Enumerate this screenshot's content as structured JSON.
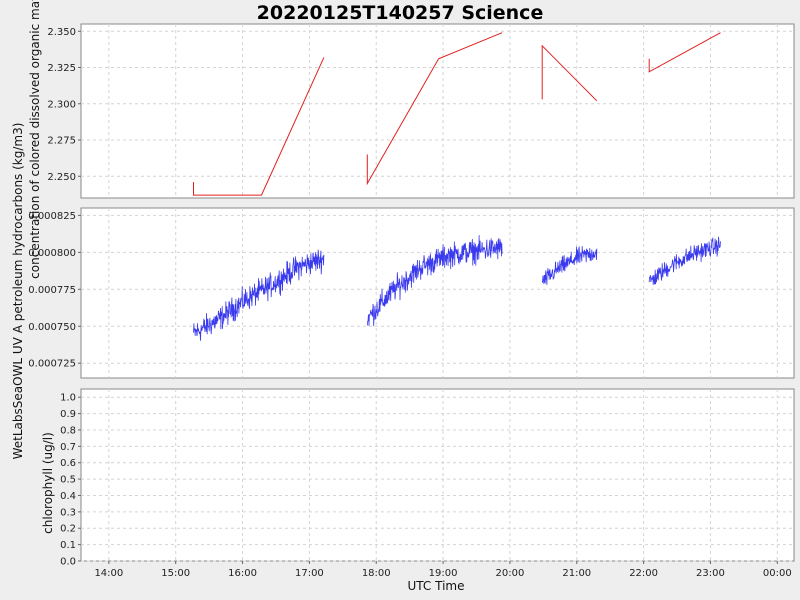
{
  "chart_data": {
    "type": "line",
    "title": "20220125T140257 Science",
    "xlabel": "UTC Time",
    "x_ticks": [
      "14:00",
      "15:00",
      "16:00",
      "17:00",
      "18:00",
      "19:00",
      "20:00",
      "21:00",
      "22:00",
      "23:00",
      "00:00"
    ],
    "xlim": [
      "13:35",
      "00:15"
    ],
    "shared_x": true,
    "grid": true,
    "panels": [
      {
        "ylabel": "concentration of colored dissolved organic matter (ppb)",
        "ylim": [
          2.235,
          2.355
        ],
        "y_ticks": [
          2.25,
          2.275,
          2.3,
          2.325,
          2.35
        ],
        "y_tick_labels": [
          "2.250",
          "2.275",
          "2.300",
          "2.325",
          "2.350"
        ],
        "color": "#e02020",
        "noisy": false,
        "segments": [
          {
            "points": [
              [
                "15:16",
                2.246
              ],
              [
                "15:16",
                2.237
              ],
              [
                "16:17",
                2.237
              ],
              [
                "17:13",
                2.332
              ]
            ]
          },
          {
            "points": [
              [
                "17:52",
                2.265
              ],
              [
                "17:52",
                2.245
              ],
              [
                "18:56",
                2.331
              ],
              [
                "19:53",
                2.349
              ]
            ]
          },
          {
            "points": [
              [
                "20:29",
                2.303
              ],
              [
                "20:29",
                2.34
              ],
              [
                "21:18",
                2.302
              ]
            ]
          },
          {
            "points": [
              [
                "22:05",
                2.331
              ],
              [
                "22:05",
                2.322
              ],
              [
                "23:09",
                2.349
              ]
            ]
          }
        ]
      },
      {
        "ylabel": "WetLabsSeaOWL UV A petroleum hydrocarbons (kg/m3)",
        "ylim": [
          0.000715,
          0.00083
        ],
        "y_ticks": [
          0.000725,
          0.00075,
          0.000775,
          0.0008,
          0.000825
        ],
        "y_tick_labels": [
          "0.000725",
          "0.000750",
          "0.000775",
          "0.000800",
          "0.000825"
        ],
        "color": "#3a3aee",
        "noisy": true,
        "segments": [
          {
            "start": "15:16",
            "end": "17:13",
            "trend": [
              0.000745,
              0.000755,
              0.000768,
              0.000778,
              0.00079,
              0.000796
            ],
            "noise": 1.2e-05
          },
          {
            "start": "17:52",
            "end": "19:53",
            "trend": [
              0.000755,
              0.000775,
              0.00079,
              0.000798,
              0.000801,
              0.000803
            ],
            "noise": 1.2e-05
          },
          {
            "start": "20:29",
            "end": "21:18",
            "trend": [
              0.00078,
              0.00079,
              0.000797,
              0.0008
            ],
            "noise": 9e-06
          },
          {
            "start": "22:05",
            "end": "23:09",
            "trend": [
              0.00078,
              0.000792,
              0.0008,
              0.000805
            ],
            "noise": 9e-06
          }
        ]
      },
      {
        "ylabel": "chlorophyll (ug/l)",
        "ylim": [
          0,
          1.05
        ],
        "y_ticks": [
          0,
          0.1,
          0.2,
          0.3,
          0.4,
          0.5,
          0.6,
          0.7,
          0.8,
          0.9,
          1.0
        ],
        "y_tick_labels": [
          "0.0",
          "0.1",
          "0.2",
          "0.3",
          "0.4",
          "0.5",
          "0.6",
          "0.7",
          "0.8",
          "0.9",
          "1.0"
        ],
        "color": "#30a030",
        "noisy": false,
        "segments": []
      }
    ]
  }
}
